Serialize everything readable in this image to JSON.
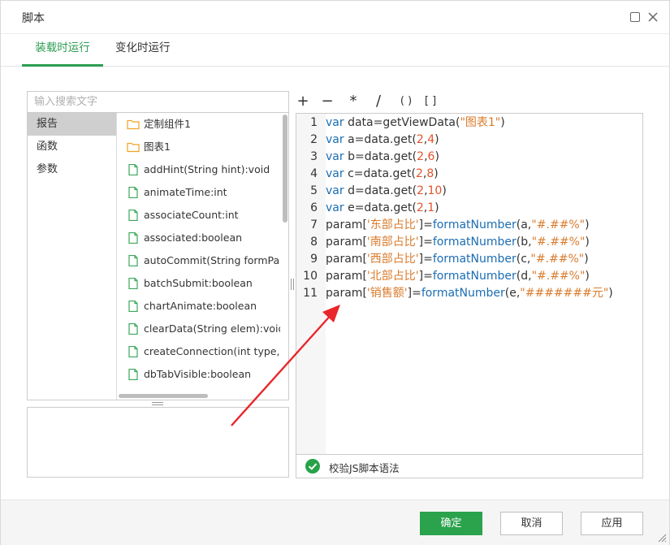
{
  "window": {
    "title": "脚本"
  },
  "tabs": [
    {
      "label": "装载时运行",
      "active": true
    },
    {
      "label": "变化时运行",
      "active": false
    }
  ],
  "search": {
    "placeholder": "输入搜索文字"
  },
  "categories": [
    {
      "label": "报告",
      "active": true
    },
    {
      "label": "函数",
      "active": false
    },
    {
      "label": "参数",
      "active": false
    }
  ],
  "items": [
    {
      "label": "定制组件1",
      "icon": "folder-icon"
    },
    {
      "label": "图表1",
      "icon": "folder-icon"
    },
    {
      "label": "addHint(String hint):void",
      "icon": "document-icon"
    },
    {
      "label": "animateTime:int",
      "icon": "document-icon"
    },
    {
      "label": "associateCount:int",
      "icon": "document-icon"
    },
    {
      "label": "associated:boolean",
      "icon": "document-icon"
    },
    {
      "label": "autoCommit(String formParm",
      "icon": "document-icon"
    },
    {
      "label": "batchSubmit:boolean",
      "icon": "document-icon"
    },
    {
      "label": "chartAnimate:boolean",
      "icon": "document-icon"
    },
    {
      "label": "clearData(String elem):void",
      "icon": "document-icon"
    },
    {
      "label": "createConnection(int type,Str",
      "icon": "document-icon"
    },
    {
      "label": "dbTabVisible:boolean",
      "icon": "document-icon"
    }
  ],
  "operators": [
    "+",
    "−",
    "*",
    "/",
    "( )",
    "[ ]"
  ],
  "editor": {
    "lines": [
      "var data=getViewData(\"图表1\")",
      "var a=data.get(2,4)",
      "var b=data.get(2,6)",
      "var c=data.get(2,8)",
      "var d=data.get(2,10)",
      "var e=data.get(2,1)",
      "param['东部占比']=formatNumber(a,\"#.##%\")",
      "param['南部占比']=formatNumber(b,\"#.##%\")",
      "param['西部占比']=formatNumber(c,\"#.##%\")",
      "param['北部占比']=formatNumber(d,\"#.##%\")",
      "param['销售额']=formatNumber(e,\"#######元\")"
    ]
  },
  "validate": {
    "label": "校验JS脚本语法"
  },
  "footer": {
    "ok_label": "确定",
    "cancel_label": "取消",
    "apply_label": "应用"
  },
  "colors": {
    "accent": "#2ba24c",
    "keyword": "#1b6db3",
    "string": "#d97b2c",
    "number": "#e0532a",
    "annotation_arrow": "#e8262b"
  }
}
